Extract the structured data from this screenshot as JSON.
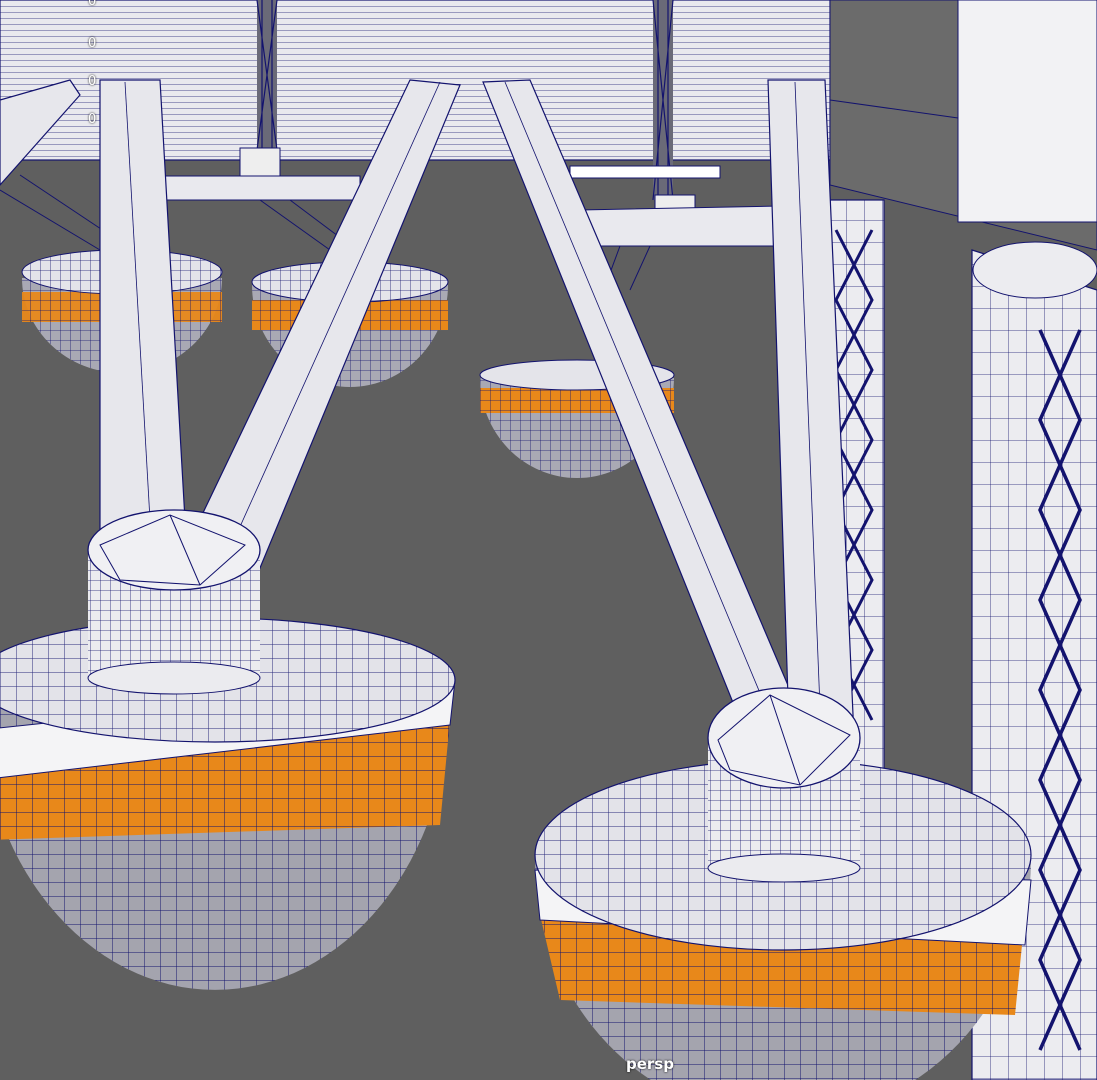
{
  "viewport": {
    "camera_label": "persp",
    "hud_values": [
      "0",
      "0",
      "0",
      "0"
    ],
    "shading_mode": "wireframe-on-shaded",
    "colors": {
      "background": "#5f5f5f",
      "mesh_surface": "#e6e6ea",
      "wire": "#13136e",
      "highlight_band": "#e8881a",
      "mesh_shadow": "#b5b5bd"
    }
  }
}
